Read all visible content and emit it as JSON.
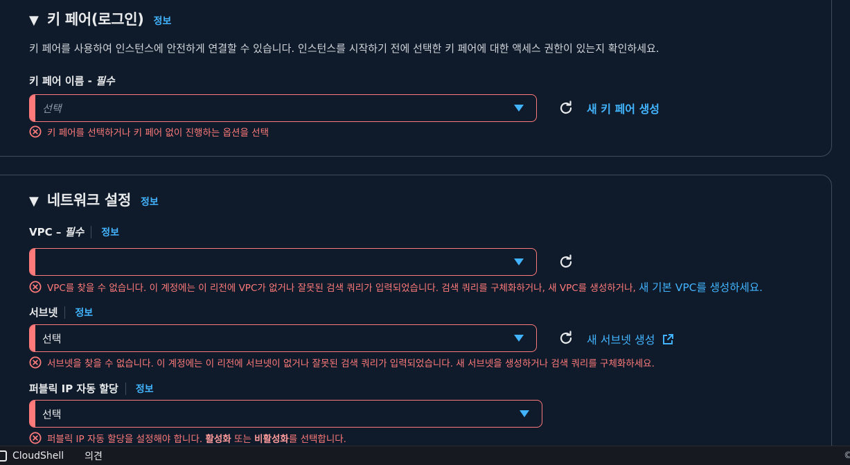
{
  "key_pair_section": {
    "title": "키 페어(로그인)",
    "info": "정보",
    "description": "키 페어를 사용하여 인스턴스에 안전하게 연결할 수 있습니다. 인스턴스를 시작하기 전에 선택한 키 페어에 대한 액세스 권한이 있는지 확인하세요.",
    "field_label": "키 페어 이름",
    "dash": " - ",
    "required": "필수",
    "placeholder": "선택",
    "create_link": "새 키 페어 생성",
    "error": "키 페어를 선택하거나 키 페어 없이 진행하는 옵션을 선택"
  },
  "network_section": {
    "title": "네트워크 설정",
    "info": "정보",
    "vpc": {
      "label": "VPC",
      "dash": " – ",
      "required": "필수",
      "info": "정보",
      "value": "",
      "error": "VPC를 찾을 수 없습니다. 이 계정에는 이 리전에 VPC가 없거나 잘못된 검색 쿼리가 입력되었습니다. 검색 쿼리를 구체화하거나, 새 VPC를 생성하거나, ",
      "error_link": "새 기본 VPC를 생성하세요."
    },
    "subnet": {
      "label": "서브넷",
      "info": "정보",
      "value": "선택",
      "create_link": "새 서브넷 생성",
      "error": "서브넷을 찾을 수 없습니다. 이 계정에는 이 리전에 서브넷이 없거나 잘못된 검색 쿼리가 입력되었습니다. 새 서브넷을 생성하거나 검색 쿼리를 구체화하세요."
    },
    "public_ip": {
      "label": "퍼블릭 IP 자동 할당",
      "info": "정보",
      "value": "선택",
      "error_pre": "퍼블릭 IP 자동 할당을 설정해야 합니다. ",
      "error_enable": "활성화",
      "error_mid": " 또는 ",
      "error_disable": "비활성화",
      "error_post": "를 선택합니다."
    }
  },
  "bottom_bar": {
    "cloudshell": "CloudShell",
    "feedback": "의견",
    "copyright": "©"
  },
  "colors": {
    "background": "#0f1b2a",
    "error": "#ff7a7a",
    "link": "#42b4ff",
    "border": "#414d5c"
  },
  "icons": [
    "triangle-down-icon",
    "refresh-icon",
    "caret-down-icon",
    "error-x-circle-icon",
    "external-link-icon",
    "cloudshell-icon"
  ]
}
